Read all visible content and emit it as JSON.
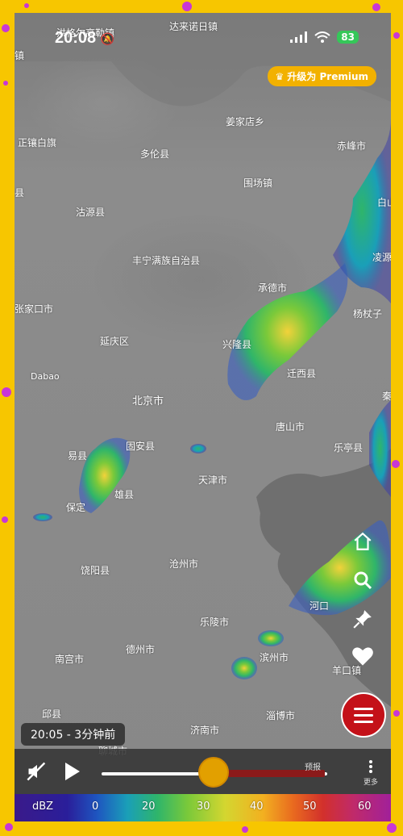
{
  "status_bar": {
    "time": "20:08",
    "battery": "83"
  },
  "premium_button": {
    "label": "升级为 Premium"
  },
  "map_labels": [
    {
      "id": "hongger",
      "text": "洪格尔高勒镇"
    },
    {
      "id": "dalai",
      "text": "达来诺日镇"
    },
    {
      "id": "zhen",
      "text": "镇"
    },
    {
      "id": "jiangjia",
      "text": "姜家店乡"
    },
    {
      "id": "zhengxiang",
      "text": "正镶白旗"
    },
    {
      "id": "duolun",
      "text": "多伦县"
    },
    {
      "id": "chifeng",
      "text": "赤峰市"
    },
    {
      "id": "xian1",
      "text": "县"
    },
    {
      "id": "weichang",
      "text": "围场镇"
    },
    {
      "id": "baishan",
      "text": "白山"
    },
    {
      "id": "guyuan",
      "text": "沽源县"
    },
    {
      "id": "fengning",
      "text": "丰宁满族自治县"
    },
    {
      "id": "lingyuan",
      "text": "凌源"
    },
    {
      "id": "chengde",
      "text": "承德市"
    },
    {
      "id": "zhangjiakou",
      "text": "张家口市"
    },
    {
      "id": "yangzhangzi",
      "text": "杨杖子"
    },
    {
      "id": "yanqing",
      "text": "延庆区"
    },
    {
      "id": "xinglong",
      "text": "兴隆县"
    },
    {
      "id": "qianxi",
      "text": "迁西县"
    },
    {
      "id": "dabao",
      "text": "Dabao"
    },
    {
      "id": "beijing",
      "text": "北京市"
    },
    {
      "id": "qin",
      "text": "秦"
    },
    {
      "id": "tangshan",
      "text": "唐山市"
    },
    {
      "id": "yixian",
      "text": "易县"
    },
    {
      "id": "guan",
      "text": "固安县"
    },
    {
      "id": "laoting",
      "text": "乐亭县"
    },
    {
      "id": "tianjin",
      "text": "天津市"
    },
    {
      "id": "xiongxian",
      "text": "雄县"
    },
    {
      "id": "baoding",
      "text": "保定"
    },
    {
      "id": "cangzhou",
      "text": "沧州市"
    },
    {
      "id": "raoyang",
      "text": "饶阳县"
    },
    {
      "id": "hekou",
      "text": "河口"
    },
    {
      "id": "leling",
      "text": "乐陵市"
    },
    {
      "id": "dezhou",
      "text": "德州市"
    },
    {
      "id": "nangong",
      "text": "南宫市"
    },
    {
      "id": "binzhou",
      "text": "滨州市"
    },
    {
      "id": "yangkou",
      "text": "羊口镇"
    },
    {
      "id": "qiuxian",
      "text": "邱县"
    },
    {
      "id": "zibo",
      "text": "淄博市"
    },
    {
      "id": "jinan",
      "text": "济南市"
    },
    {
      "id": "liaocheng",
      "text": "聊城市"
    }
  ],
  "timestamp": "20:05 - 3分钟前",
  "player": {
    "forecast_label": "预报",
    "more_label": "更多",
    "progress_fraction": 0.49
  },
  "scale": {
    "unit": "dBZ",
    "ticks": [
      "0",
      "20",
      "30",
      "40",
      "50",
      "60"
    ]
  },
  "colors": {
    "premium": "#f2b100",
    "menu": "#c41119",
    "thumb": "#e2a000",
    "forecast": "#8b1a1a"
  }
}
